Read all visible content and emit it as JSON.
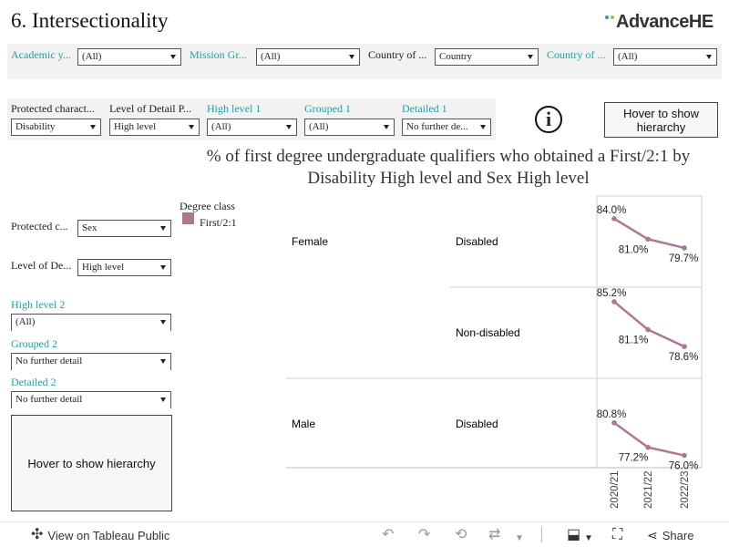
{
  "header": {
    "title": "6. Intersectionality",
    "logo_text": "AdvanceHE",
    "logo_dot_colors": [
      "#1aa3a8",
      "#8cc63f"
    ]
  },
  "filters_top": [
    {
      "label": "Academic y...",
      "value": "(All)",
      "label_color": "teal"
    },
    {
      "label": "Mission Gr...",
      "value": "(All)",
      "label_color": "teal"
    },
    {
      "label": "Country of ...",
      "value": "Country",
      "label_color": "dark"
    },
    {
      "label": "Country of ...",
      "value": "(All)",
      "label_color": "teal"
    }
  ],
  "filters_second": [
    {
      "label": "Protected charact...",
      "value": "Disability",
      "label_color": "dark"
    },
    {
      "label": "Level of Detail P...",
      "value": "High level",
      "label_color": "dark"
    },
    {
      "label": "High level 1",
      "value": "(All)",
      "label_color": "teal"
    },
    {
      "label": "Grouped 1",
      "value": "(All)",
      "label_color": "teal"
    },
    {
      "label": "Detailed 1",
      "value": "No further de...",
      "label_color": "teal"
    }
  ],
  "info_icon_glyph": "i",
  "hover_top_label": "Hover to show hierarchy",
  "hover_left_label": "Hover to show hierarchy",
  "chart_title": "% of first degree undergraduate qualifiers who obtained a First/2:1 by Disability High level and Sex High level",
  "legend": {
    "title": "Degree class",
    "entries": [
      {
        "label": "First/2:1",
        "color": "#b07595"
      }
    ]
  },
  "filters_left": {
    "protected": {
      "label": "Protected c...",
      "value": "Sex"
    },
    "level_of_detail": {
      "label": "Level of De...",
      "value": "High level"
    },
    "high_level_2": {
      "label": "High level 2",
      "value": "(All)"
    },
    "grouped_2": {
      "label": "Grouped 2",
      "value": "No further detail"
    },
    "detailed_2": {
      "label": "Detailed 2",
      "value": "No further detail"
    }
  },
  "chart_data": {
    "type": "line",
    "title": "% of first degree undergraduate qualifiers who obtained a First/2:1 by Disability High level and Sex High level",
    "x": [
      "2020/21",
      "2021/22",
      "2022/23"
    ],
    "series_color": "#b07595",
    "value_format": "percent_1dp",
    "rows": [
      {
        "sex": "Female",
        "disability": "Disabled",
        "values": [
          84.0,
          81.0,
          79.7
        ],
        "labels": [
          "84.0%",
          "81.0%",
          "79.7%"
        ]
      },
      {
        "sex": "",
        "disability": "Non-disabled",
        "values": [
          85.2,
          81.1,
          78.6
        ],
        "labels": [
          "85.2%",
          "81.1%",
          "78.6%"
        ]
      },
      {
        "sex": "Male",
        "disability": "Disabled",
        "values": [
          80.8,
          77.2,
          76.0
        ],
        "labels": [
          "80.8%",
          "77.2%",
          "76.0%"
        ]
      }
    ],
    "ylim": [
      75.0,
      86.0
    ],
    "legend_title": "Degree class",
    "series": [
      {
        "name": "First/2:1",
        "values": [
          84.0,
          81.0,
          79.7,
          85.2,
          81.1,
          78.6,
          80.8,
          77.2,
          76.0
        ]
      }
    ]
  },
  "toolbar": {
    "view_label": "View on Tableau Public",
    "share_label": "Share"
  }
}
